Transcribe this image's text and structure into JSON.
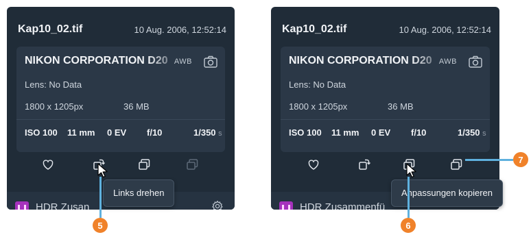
{
  "panels": [
    {
      "filename": "Kap10_02.tif",
      "datetime": "10 Aug. 2006, 12:52:14",
      "camera": "NIKON CORPORATION D20",
      "awb": "AWB",
      "lens": "Lens: No Data",
      "dimensions": "1800 x 1205px",
      "file_size": "36 MB",
      "exposure": {
        "iso": "ISO 100",
        "focal": "11 mm",
        "ev": "0 EV",
        "aperture": "f/10",
        "shutter": "1/350",
        "shutter_unit": "s"
      },
      "preset_label": "HDR Zusan",
      "tooltip": "Links drehen"
    },
    {
      "filename": "Kap10_02.tif",
      "datetime": "10 Aug. 2006, 12:52:14",
      "camera": "NIKON CORPORATION D20",
      "awb": "AWB",
      "lens": "Lens: No Data",
      "dimensions": "1800 x 1205px",
      "file_size": "36 MB",
      "exposure": {
        "iso": "ISO 100",
        "focal": "11 mm",
        "ev": "0 EV",
        "aperture": "f/10",
        "shutter": "1/350",
        "shutter_unit": "s"
      },
      "preset_label": "HDR Zusammenfü",
      "tooltip": "Anpassungen kopieren"
    }
  ],
  "callouts": [
    "5",
    "6",
    "7"
  ],
  "icons": [
    "heart-icon",
    "rotate-left-icon",
    "copy-adjustments-icon",
    "paste-adjustments-icon",
    "camera-icon",
    "gear-icon"
  ],
  "colors": {
    "panel_bg": "#202c38",
    "card_bg": "#2b3847",
    "callout": "#f0822a",
    "callout_line": "#5fb1de",
    "preset_icon": "#a632bd"
  }
}
